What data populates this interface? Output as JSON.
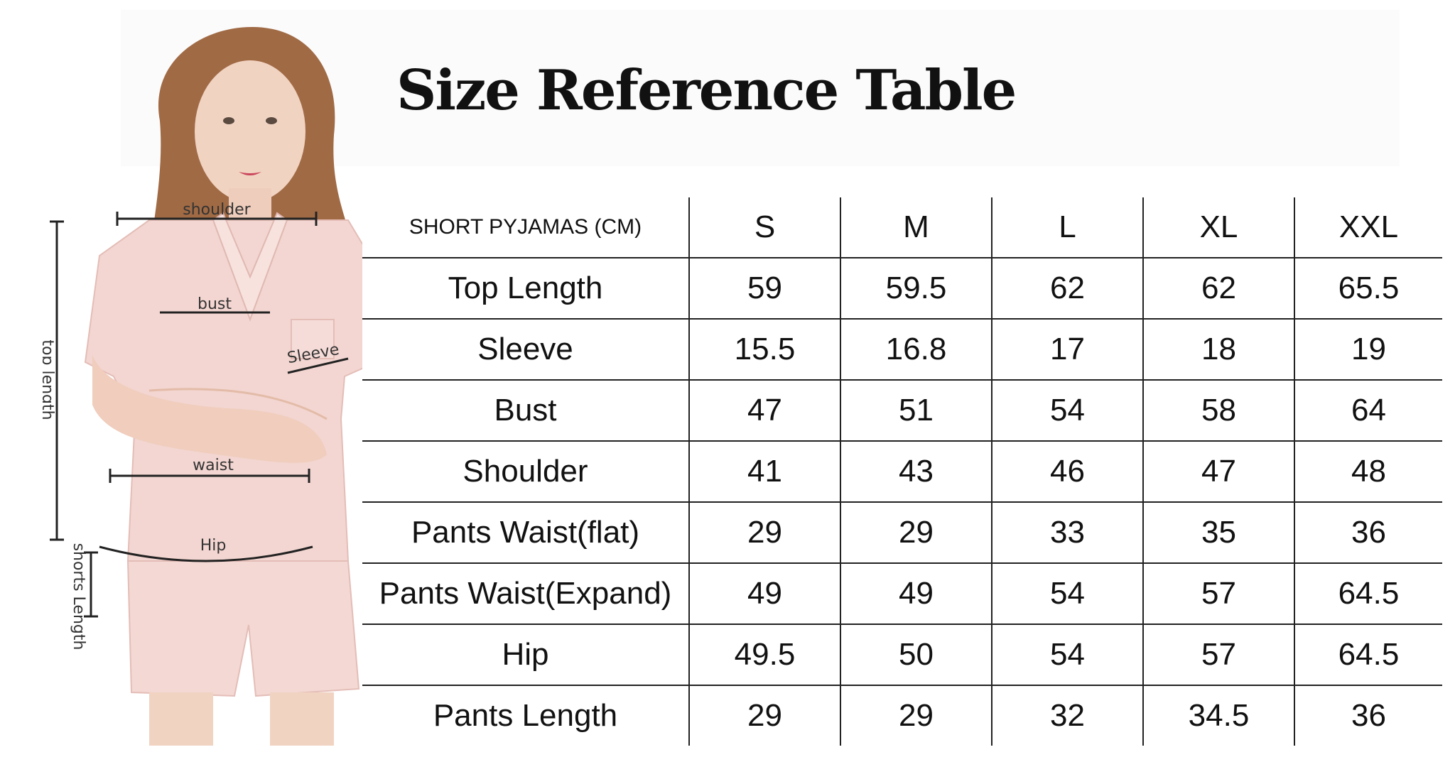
{
  "title": "Size Reference Table",
  "figure": {
    "labels": {
      "shoulder": "shoulder",
      "bust": "bust",
      "sleeve": "Sleeve",
      "top_length": "top length",
      "waist": "waist",
      "hip": "Hip",
      "shorts_length": "shorts Length"
    }
  },
  "table": {
    "header_label": "SHORT PYJAMAS (CM)",
    "sizes": [
      "S",
      "M",
      "L",
      "XL",
      "XXL"
    ],
    "rows": [
      {
        "label": "Top Length",
        "values": [
          "59",
          "59.5",
          "62",
          "62",
          "65.5"
        ]
      },
      {
        "label": "Sleeve",
        "values": [
          "15.5",
          "16.8",
          "17",
          "18",
          "19"
        ]
      },
      {
        "label": "Bust",
        "values": [
          "47",
          "51",
          "54",
          "58",
          "64"
        ]
      },
      {
        "label": "Shoulder",
        "values": [
          "41",
          "43",
          "46",
          "47",
          "48"
        ]
      },
      {
        "label": "Pants Waist(flat)",
        "values": [
          "29",
          "29",
          "33",
          "35",
          "36"
        ]
      },
      {
        "label": "Pants Waist(Expand)",
        "values": [
          "49",
          "49",
          "54",
          "57",
          "64.5"
        ]
      },
      {
        "label": "Hip",
        "values": [
          "49.5",
          "50",
          "54",
          "57",
          "64.5"
        ]
      },
      {
        "label": "Pants Length",
        "values": [
          "29",
          "29",
          "32",
          "34.5",
          "36"
        ]
      }
    ]
  }
}
